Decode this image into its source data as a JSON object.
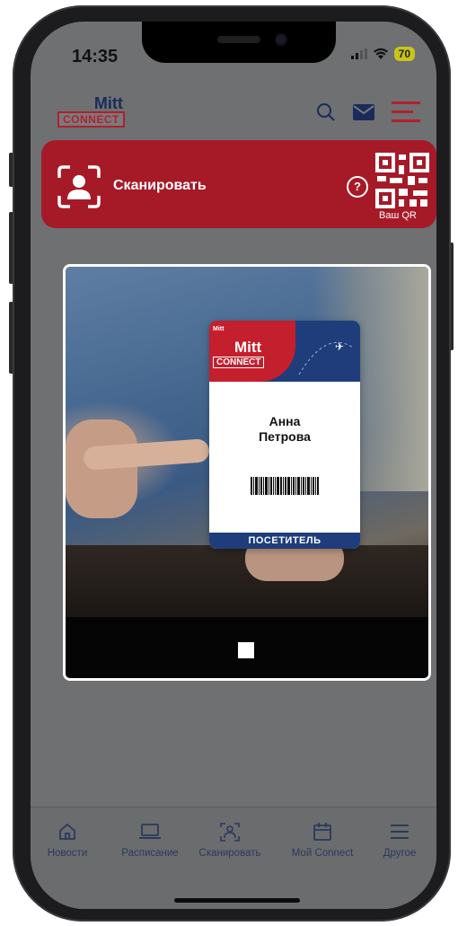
{
  "status": {
    "time": "14:35",
    "battery": "70"
  },
  "header": {
    "logo_top": "Mitt",
    "logo_bottom": "CONNECT"
  },
  "scan_banner": {
    "label": "Сканировать",
    "help": "?",
    "qr_label": "Ваш QR"
  },
  "badge": {
    "logo_top": "Mitt",
    "logo_bottom": "CONNECT",
    "first_name": "Анна",
    "last_name": "Петрова",
    "role": "ПОСЕТИТЕЛЬ"
  },
  "nav": [
    {
      "label": "Новости",
      "icon": "home-icon"
    },
    {
      "label": "Расписание",
      "icon": "laptop-icon"
    },
    {
      "label": "Сканировать",
      "icon": "scan-user-icon"
    },
    {
      "label": "Мой Connect",
      "icon": "calendar-icon"
    },
    {
      "label": "Другое",
      "icon": "menu-icon"
    }
  ],
  "colors": {
    "brand_red": "#a61a28",
    "brand_navy": "#1e3d7a",
    "overlay": "#6e7072"
  }
}
